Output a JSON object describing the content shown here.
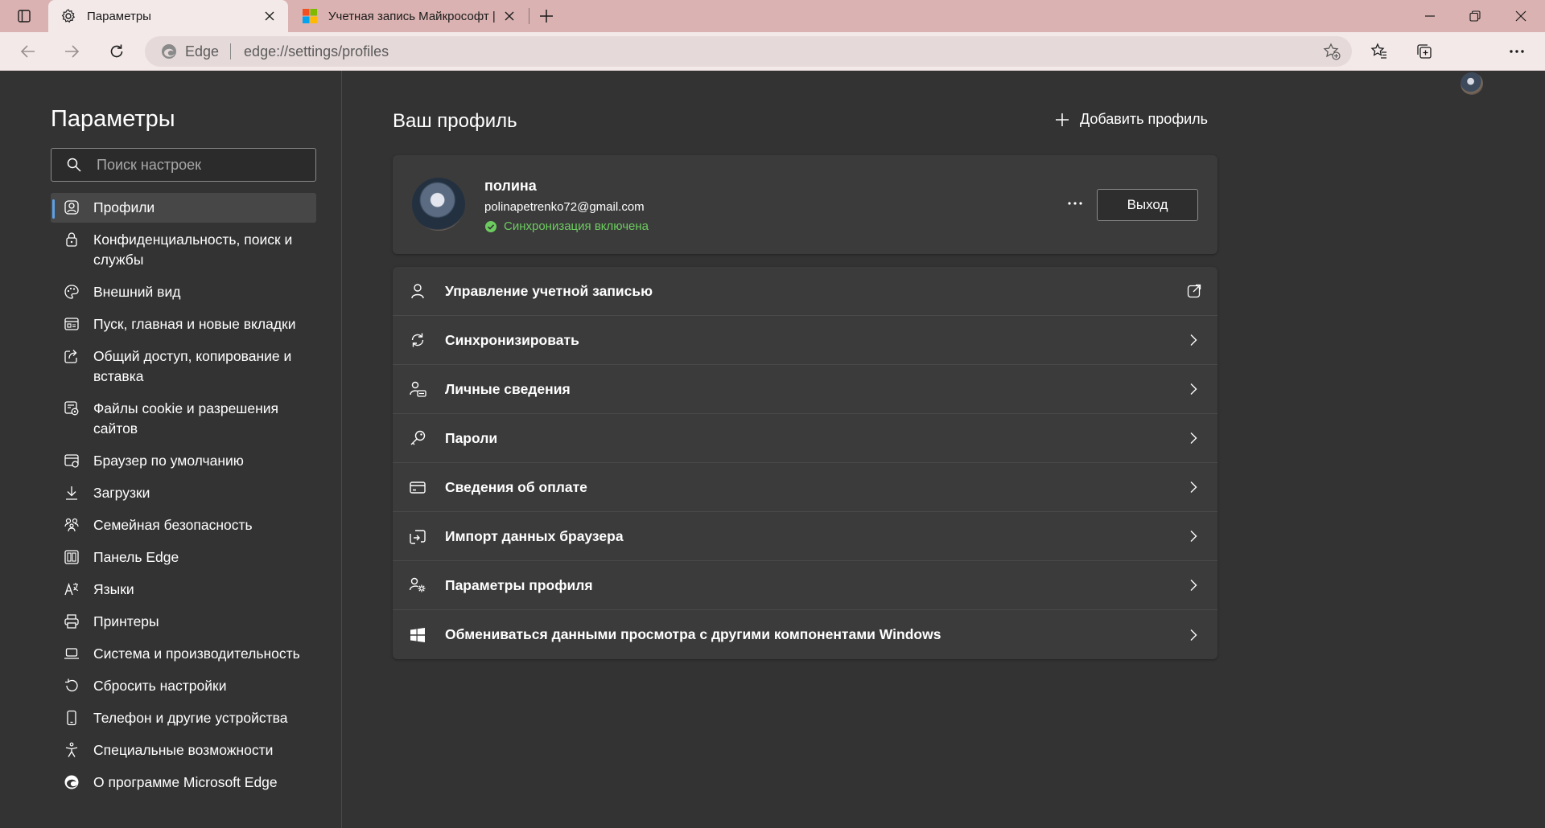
{
  "browser": {
    "tabs": [
      {
        "title": "Параметры",
        "active": true,
        "icon": "gear-icon"
      },
      {
        "title": "Учетная запись Майкрософт | В",
        "active": false,
        "icon": "microsoft-logo-icon"
      }
    ],
    "address": {
      "brand": "Edge",
      "url": "edge://settings/profiles"
    }
  },
  "sidebar": {
    "title": "Параметры",
    "search_placeholder": "Поиск настроек",
    "items": [
      {
        "label": "Профили",
        "icon": "profile-icon",
        "selected": true
      },
      {
        "label": "Конфиденциальность, поиск и службы",
        "icon": "lock-icon"
      },
      {
        "label": "Внешний вид",
        "icon": "palette-icon"
      },
      {
        "label": "Пуск, главная и новые вкладки",
        "icon": "start-page-icon"
      },
      {
        "label": "Общий доступ, копирование и вставка",
        "icon": "share-icon"
      },
      {
        "label": "Файлы cookie и разрешения сайтов",
        "icon": "cookie-permissions-icon"
      },
      {
        "label": "Браузер по умолчанию",
        "icon": "default-browser-icon"
      },
      {
        "label": "Загрузки",
        "icon": "download-icon"
      },
      {
        "label": "Семейная безопасность",
        "icon": "family-icon"
      },
      {
        "label": "Панель Edge",
        "icon": "edge-bar-icon"
      },
      {
        "label": "Языки",
        "icon": "language-icon"
      },
      {
        "label": "Принтеры",
        "icon": "printer-icon"
      },
      {
        "label": "Система и производительность",
        "icon": "laptop-icon"
      },
      {
        "label": "Сбросить настройки",
        "icon": "reset-icon"
      },
      {
        "label": "Телефон и другие устройства",
        "icon": "phone-icon"
      },
      {
        "label": "Специальные возможности",
        "icon": "accessibility-icon"
      },
      {
        "label": "О программе Microsoft Edge",
        "icon": "edge-logo-icon"
      }
    ]
  },
  "main": {
    "title": "Ваш профиль",
    "add_profile": "Добавить профиль",
    "profile": {
      "name": "полина",
      "email": "polinapetrenko72@gmail.com",
      "sync_status": "Синхронизация включена",
      "logout": "Выход"
    },
    "rows": [
      {
        "label": "Управление учетной записью",
        "icon": "person-icon",
        "action": "external-link-icon"
      },
      {
        "label": "Синхронизировать",
        "icon": "sync-icon",
        "action": "chevron-right-icon"
      },
      {
        "label": "Личные сведения",
        "icon": "personal-info-icon",
        "action": "chevron-right-icon"
      },
      {
        "label": "Пароли",
        "icon": "key-icon",
        "action": "chevron-right-icon"
      },
      {
        "label": "Сведения об оплате",
        "icon": "credit-card-icon",
        "action": "chevron-right-icon"
      },
      {
        "label": "Импорт данных браузера",
        "icon": "import-icon",
        "action": "chevron-right-icon"
      },
      {
        "label": "Параметры профиля",
        "icon": "profile-settings-icon",
        "action": "chevron-right-icon"
      },
      {
        "label": "Обмениваться данными просмотра с другими компонентами Windows",
        "icon": "windows-logo-icon",
        "action": "chevron-right-icon"
      }
    ]
  },
  "colors": {
    "titlebar": "#d9b2b1",
    "toolbar": "#f3e9e9",
    "page_bg": "#333333",
    "card_bg": "#3b3b3b",
    "accent": "#5ca1e6",
    "sync_ok": "#6ccb5f"
  }
}
